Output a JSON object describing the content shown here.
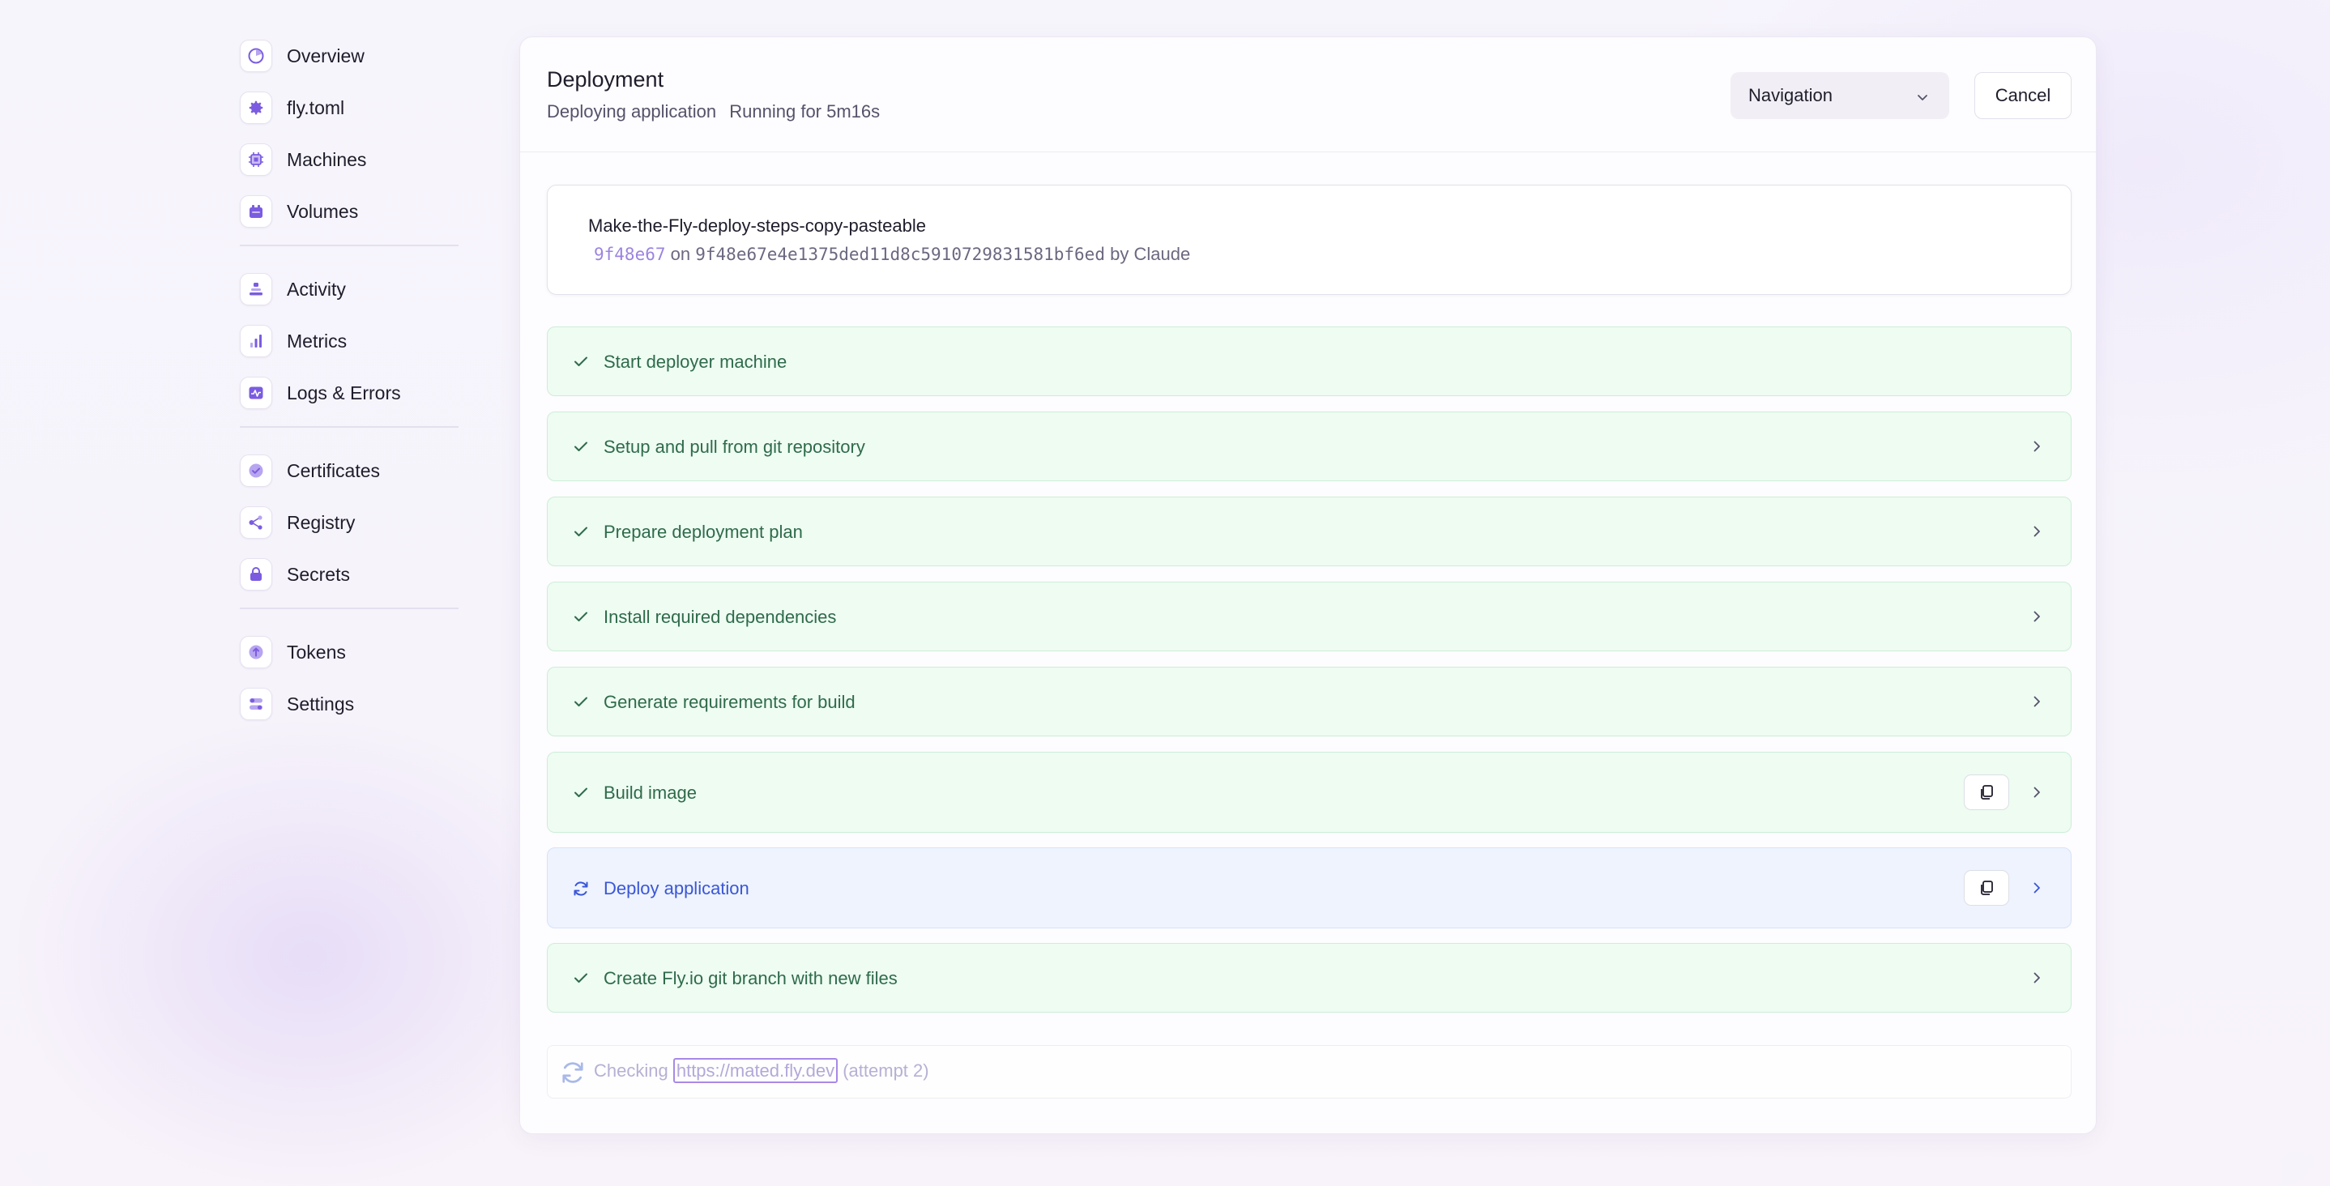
{
  "sidebar": {
    "groups": [
      [
        {
          "label": "Overview",
          "icon": "overview-icon"
        },
        {
          "label": "fly.toml",
          "icon": "gear-icon"
        },
        {
          "label": "Machines",
          "icon": "chip-icon"
        },
        {
          "label": "Volumes",
          "icon": "volume-icon"
        }
      ],
      [
        {
          "label": "Activity",
          "icon": "activity-icon"
        },
        {
          "label": "Metrics",
          "icon": "bar-chart-icon"
        },
        {
          "label": "Logs & Errors",
          "icon": "pulse-icon"
        }
      ],
      [
        {
          "label": "Certificates",
          "icon": "badge-check-icon"
        },
        {
          "label": "Registry",
          "icon": "share-icon"
        },
        {
          "label": "Secrets",
          "icon": "lock-icon"
        }
      ],
      [
        {
          "label": "Tokens",
          "icon": "token-icon"
        },
        {
          "label": "Settings",
          "icon": "sliders-icon"
        }
      ]
    ]
  },
  "header": {
    "title": "Deployment",
    "status": "Deploying application",
    "running": "Running for 5m16s",
    "navigation_label": "Navigation",
    "cancel_label": "Cancel"
  },
  "commit": {
    "branch": "Make-the-Fly-deploy-steps-copy-pasteable",
    "short_hash": "9f48e67",
    "on": "on",
    "full_hash": "9f48e67e4e1375ded11d8c5910729831581bf6ed",
    "by": "by Claude"
  },
  "steps": [
    {
      "label": "Start deployer machine",
      "state": "done",
      "expandable": false,
      "copyable": false
    },
    {
      "label": "Setup and pull from git repository",
      "state": "done",
      "expandable": true,
      "copyable": false
    },
    {
      "label": "Prepare deployment plan",
      "state": "done",
      "expandable": true,
      "copyable": false
    },
    {
      "label": "Install required dependencies",
      "state": "done",
      "expandable": true,
      "copyable": false
    },
    {
      "label": "Generate requirements for build",
      "state": "done",
      "expandable": true,
      "copyable": false
    },
    {
      "label": "Build image",
      "state": "done",
      "expandable": true,
      "copyable": true
    },
    {
      "label": "Deploy application",
      "state": "running",
      "expandable": true,
      "copyable": true
    },
    {
      "label": "Create Fly.io git branch with new files",
      "state": "done",
      "expandable": true,
      "copyable": false
    }
  ],
  "status_bar": {
    "prefix": "Checking",
    "url": "https://mated.fly.dev",
    "suffix": "(attempt 2)"
  },
  "colors": {
    "accent": "#7b5ce0",
    "success_bg": "#eefcf2",
    "success_text": "#2f6b4a",
    "running_bg": "#eef3fe",
    "running_text": "#3a56d6"
  }
}
